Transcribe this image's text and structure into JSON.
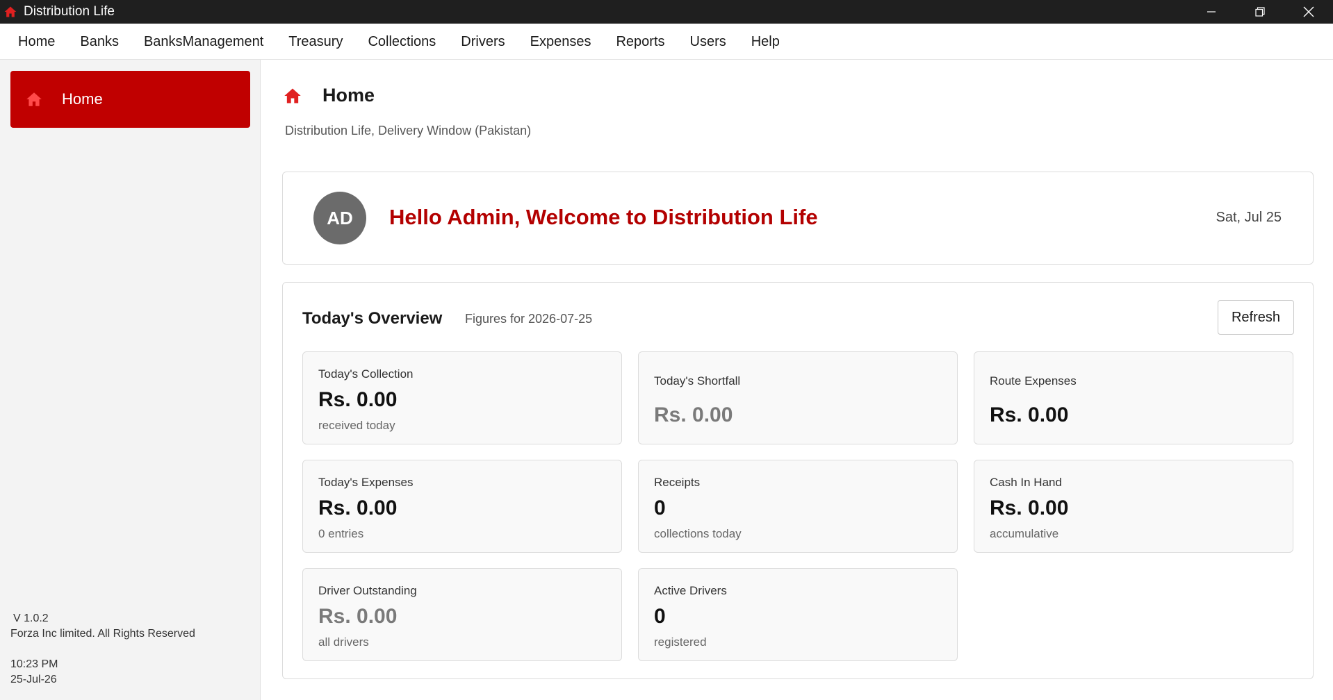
{
  "window": {
    "title": "Distribution Life",
    "controls": [
      "minimize-icon",
      "restore-icon",
      "close-icon"
    ]
  },
  "menu": [
    "Home",
    "Banks",
    "BanksManagement",
    "Treasury",
    "Collections",
    "Drivers",
    "Expenses",
    "Reports",
    "Users",
    "Help"
  ],
  "sidebar": {
    "active_item": {
      "label": "Home",
      "icon": "home-icon"
    },
    "version": "V 1.0.2",
    "copyright": "Forza Inc limited. All Rights Reserved",
    "time": "10:23 PM",
    "date": "25-Jul-26"
  },
  "page": {
    "title": "Home",
    "icon": "home-icon",
    "subtitle": "Distribution Life, Delivery Window (Pakistan)"
  },
  "welcome": {
    "avatar_initials": "AD",
    "message": "Hello Admin, Welcome to Distribution Life",
    "date": "Sat, Jul 25"
  },
  "overview": {
    "title": "Today's Overview",
    "subtitle": "Figures for 2026-07-25",
    "refresh_label": "Refresh",
    "tiles": [
      {
        "label": "Today's Collection",
        "value": "Rs. 0.00",
        "note": "received today"
      },
      {
        "label": "Today's Shortfall",
        "value": "Rs. 0.00",
        "note": ""
      },
      {
        "label": "Route Expenses",
        "value": "Rs. 0.00",
        "note": ""
      },
      {
        "label": "Today's Expenses",
        "value": "Rs. 0.00",
        "note": "0 entries"
      },
      {
        "label": "Receipts",
        "value": "0",
        "note": "collections today"
      },
      {
        "label": "Cash In Hand",
        "value": "Rs. 0.00",
        "note": "accumulative"
      },
      {
        "label": "Driver Outstanding",
        "value": "Rs. 0.00",
        "note": "all drivers"
      },
      {
        "label": "Active Drivers",
        "value": "0",
        "note": "registered"
      }
    ]
  },
  "colors": {
    "brand_red": "#c00000",
    "welcome_red": "#b30000",
    "titlebar": "#1f1f1f",
    "sidebar_bg": "#f3f3f3",
    "muted_value": "#7a7a7a"
  }
}
